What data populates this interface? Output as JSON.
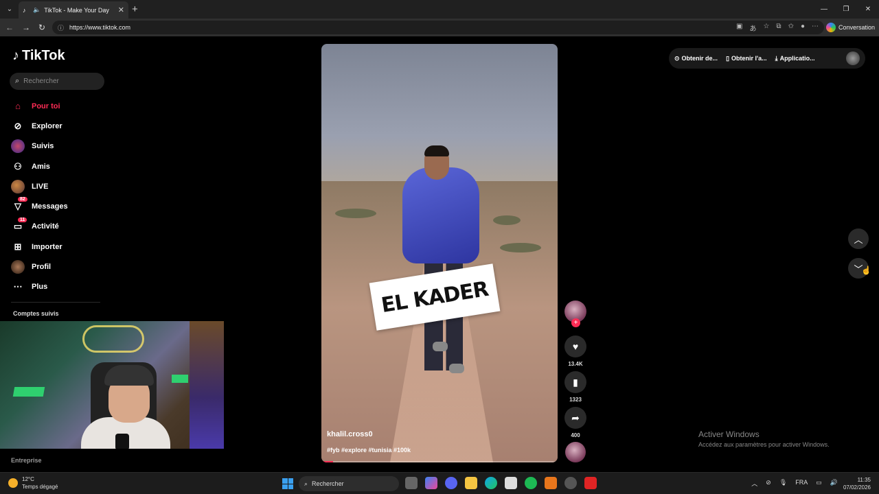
{
  "browser": {
    "tab_title": "TikTok - Make Your Day",
    "url": "https://www.tiktok.com",
    "copilot_label": "Conversation"
  },
  "sidebar": {
    "logo": "TikTok",
    "search_placeholder": "Rechercher",
    "items": [
      {
        "label": "Pour toi",
        "icon": "home-icon",
        "active": true
      },
      {
        "label": "Explorer",
        "icon": "compass-icon"
      },
      {
        "label": "Suivis",
        "icon": "following-avatar"
      },
      {
        "label": "Amis",
        "icon": "friends-icon"
      },
      {
        "label": "LIVE",
        "icon": "live-avatar"
      },
      {
        "label": "Messages",
        "icon": "messages-icon",
        "badge": "82"
      },
      {
        "label": "Activité",
        "icon": "activity-icon",
        "badge": "11"
      },
      {
        "label": "Importer",
        "icon": "upload-icon"
      },
      {
        "label": "Profil",
        "icon": "profile-avatar"
      },
      {
        "label": "Plus",
        "icon": "more-icon"
      }
    ],
    "following_heading": "Comptes suivis",
    "footer": "Entreprise"
  },
  "video": {
    "sticker_text": "EL KADER",
    "username": "khalil.cross0",
    "hashtags": "#fyb #explore #tunisia #100k",
    "progress": 0.05
  },
  "actions": {
    "likes": "13.4K",
    "saves": "1323",
    "shares": "400"
  },
  "topbar": {
    "item1": "Obtenir de...",
    "item2": "Obtenir l'a...",
    "item3": "Applicatio..."
  },
  "watermark": {
    "line1": "Activer Windows",
    "line2": "Accédez aux paramètres pour activer Windows."
  },
  "taskbar": {
    "temp": "12°C",
    "weather": "Temps dégagé",
    "search": "Rechercher",
    "lang": "FRA",
    "time": "11:35",
    "date": "07/02/2026"
  },
  "colors": {
    "accent": "#fe2c55",
    "background": "#000000"
  }
}
